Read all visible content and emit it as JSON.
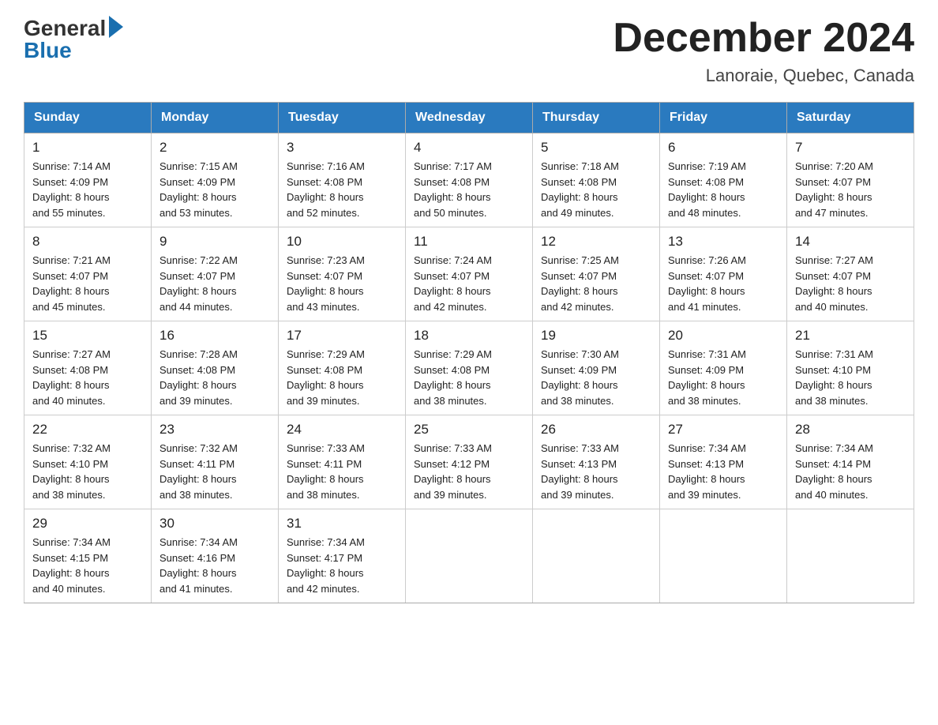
{
  "header": {
    "logo_general": "General",
    "logo_blue": "Blue",
    "month_title": "December 2024",
    "location": "Lanoraie, Quebec, Canada"
  },
  "days_of_week": [
    "Sunday",
    "Monday",
    "Tuesday",
    "Wednesday",
    "Thursday",
    "Friday",
    "Saturday"
  ],
  "weeks": [
    [
      {
        "day": "1",
        "sunrise": "7:14 AM",
        "sunset": "4:09 PM",
        "daylight": "8 hours and 55 minutes."
      },
      {
        "day": "2",
        "sunrise": "7:15 AM",
        "sunset": "4:09 PM",
        "daylight": "8 hours and 53 minutes."
      },
      {
        "day": "3",
        "sunrise": "7:16 AM",
        "sunset": "4:08 PM",
        "daylight": "8 hours and 52 minutes."
      },
      {
        "day": "4",
        "sunrise": "7:17 AM",
        "sunset": "4:08 PM",
        "daylight": "8 hours and 50 minutes."
      },
      {
        "day": "5",
        "sunrise": "7:18 AM",
        "sunset": "4:08 PM",
        "daylight": "8 hours and 49 minutes."
      },
      {
        "day": "6",
        "sunrise": "7:19 AM",
        "sunset": "4:08 PM",
        "daylight": "8 hours and 48 minutes."
      },
      {
        "day": "7",
        "sunrise": "7:20 AM",
        "sunset": "4:07 PM",
        "daylight": "8 hours and 47 minutes."
      }
    ],
    [
      {
        "day": "8",
        "sunrise": "7:21 AM",
        "sunset": "4:07 PM",
        "daylight": "8 hours and 45 minutes."
      },
      {
        "day": "9",
        "sunrise": "7:22 AM",
        "sunset": "4:07 PM",
        "daylight": "8 hours and 44 minutes."
      },
      {
        "day": "10",
        "sunrise": "7:23 AM",
        "sunset": "4:07 PM",
        "daylight": "8 hours and 43 minutes."
      },
      {
        "day": "11",
        "sunrise": "7:24 AM",
        "sunset": "4:07 PM",
        "daylight": "8 hours and 42 minutes."
      },
      {
        "day": "12",
        "sunrise": "7:25 AM",
        "sunset": "4:07 PM",
        "daylight": "8 hours and 42 minutes."
      },
      {
        "day": "13",
        "sunrise": "7:26 AM",
        "sunset": "4:07 PM",
        "daylight": "8 hours and 41 minutes."
      },
      {
        "day": "14",
        "sunrise": "7:27 AM",
        "sunset": "4:07 PM",
        "daylight": "8 hours and 40 minutes."
      }
    ],
    [
      {
        "day": "15",
        "sunrise": "7:27 AM",
        "sunset": "4:08 PM",
        "daylight": "8 hours and 40 minutes."
      },
      {
        "day": "16",
        "sunrise": "7:28 AM",
        "sunset": "4:08 PM",
        "daylight": "8 hours and 39 minutes."
      },
      {
        "day": "17",
        "sunrise": "7:29 AM",
        "sunset": "4:08 PM",
        "daylight": "8 hours and 39 minutes."
      },
      {
        "day": "18",
        "sunrise": "7:29 AM",
        "sunset": "4:08 PM",
        "daylight": "8 hours and 38 minutes."
      },
      {
        "day": "19",
        "sunrise": "7:30 AM",
        "sunset": "4:09 PM",
        "daylight": "8 hours and 38 minutes."
      },
      {
        "day": "20",
        "sunrise": "7:31 AM",
        "sunset": "4:09 PM",
        "daylight": "8 hours and 38 minutes."
      },
      {
        "day": "21",
        "sunrise": "7:31 AM",
        "sunset": "4:10 PM",
        "daylight": "8 hours and 38 minutes."
      }
    ],
    [
      {
        "day": "22",
        "sunrise": "7:32 AM",
        "sunset": "4:10 PM",
        "daylight": "8 hours and 38 minutes."
      },
      {
        "day": "23",
        "sunrise": "7:32 AM",
        "sunset": "4:11 PM",
        "daylight": "8 hours and 38 minutes."
      },
      {
        "day": "24",
        "sunrise": "7:33 AM",
        "sunset": "4:11 PM",
        "daylight": "8 hours and 38 minutes."
      },
      {
        "day": "25",
        "sunrise": "7:33 AM",
        "sunset": "4:12 PM",
        "daylight": "8 hours and 39 minutes."
      },
      {
        "day": "26",
        "sunrise": "7:33 AM",
        "sunset": "4:13 PM",
        "daylight": "8 hours and 39 minutes."
      },
      {
        "day": "27",
        "sunrise": "7:34 AM",
        "sunset": "4:13 PM",
        "daylight": "8 hours and 39 minutes."
      },
      {
        "day": "28",
        "sunrise": "7:34 AM",
        "sunset": "4:14 PM",
        "daylight": "8 hours and 40 minutes."
      }
    ],
    [
      {
        "day": "29",
        "sunrise": "7:34 AM",
        "sunset": "4:15 PM",
        "daylight": "8 hours and 40 minutes."
      },
      {
        "day": "30",
        "sunrise": "7:34 AM",
        "sunset": "4:16 PM",
        "daylight": "8 hours and 41 minutes."
      },
      {
        "day": "31",
        "sunrise": "7:34 AM",
        "sunset": "4:17 PM",
        "daylight": "8 hours and 42 minutes."
      },
      null,
      null,
      null,
      null
    ]
  ],
  "labels": {
    "sunrise": "Sunrise:",
    "sunset": "Sunset:",
    "daylight": "Daylight:"
  }
}
